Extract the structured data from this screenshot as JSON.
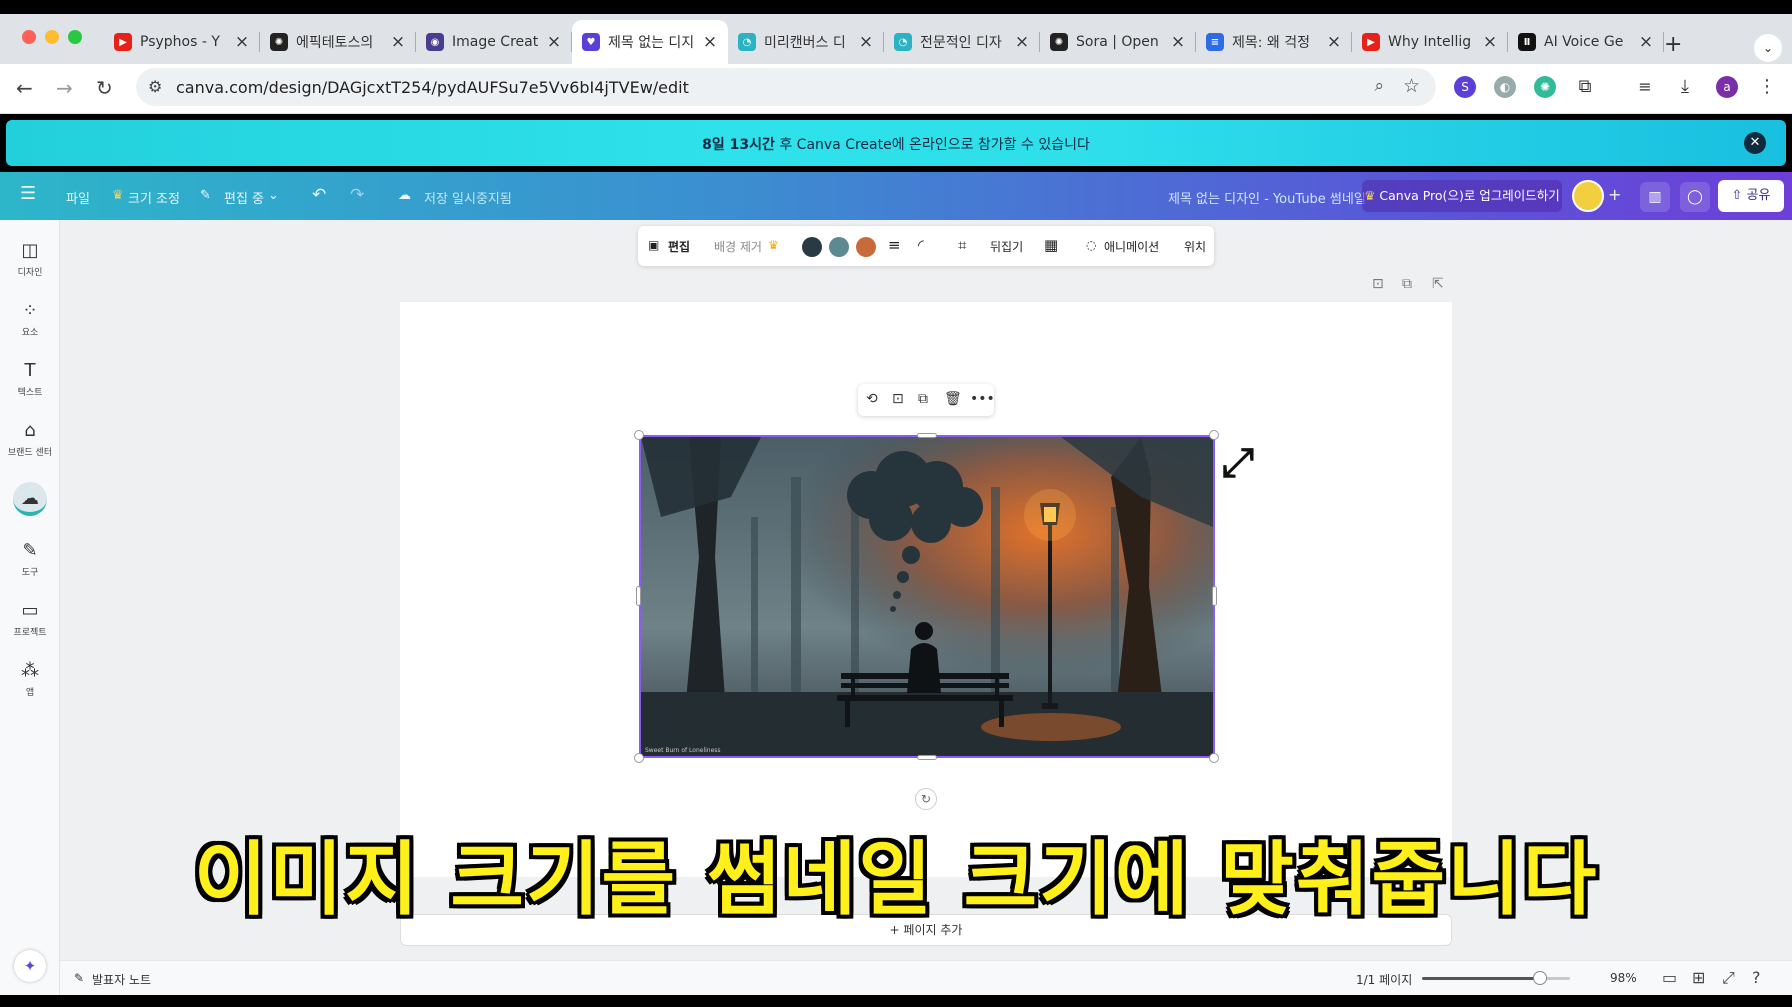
{
  "browser": {
    "tabs": [
      {
        "title": "Psyphos - Y",
        "icon": "youtube-icon",
        "color": "#e62117"
      },
      {
        "title": "에픽테토스의",
        "icon": "openai-icon",
        "color": "#222222"
      },
      {
        "title": "Image Creat",
        "icon": "image-creator-icon",
        "color": "#4a3d8f"
      },
      {
        "title": "제목 없는 디지",
        "icon": "canva-icon",
        "color": "#5b3fd9"
      },
      {
        "title": "미리캔버스 디",
        "icon": "miricanvas-icon",
        "color": "#2bb3c4"
      },
      {
        "title": "전문적인 디자",
        "icon": "miricanvas-icon",
        "color": "#2bb3c4"
      },
      {
        "title": "Sora | Open",
        "icon": "openai-icon",
        "color": "#222222"
      },
      {
        "title": "제목: 왜 걱정",
        "icon": "google-docs-icon",
        "color": "#2e6ce6"
      },
      {
        "title": "Why Intellig",
        "icon": "youtube-icon",
        "color": "#e62117"
      },
      {
        "title": "AI Voice Ge",
        "icon": "elevenlabs-icon",
        "color": "#111111"
      }
    ],
    "url": "canva.com/design/DAGjcxtT254/pydAUFSu7e5Vv6bI4jTVEw/edit",
    "profile_initial": "a"
  },
  "banner": {
    "bold": "8일 13시간",
    "rest": " 후 Canva Create에 온라인으로 참가할 수 있습니다"
  },
  "header": {
    "file": "파일",
    "resize": "크기 조정",
    "editing": "편집 중",
    "save_status": "저장 일시중지됨",
    "doc_title": "제목 없는 디자인 - YouTube 썸네일",
    "upgrade": "Canva Pro(으)로 업그레이드하기",
    "share": "공유"
  },
  "sidebar": [
    {
      "label": "디자인",
      "icon": "layout-icon"
    },
    {
      "label": "요소",
      "icon": "elements-icon"
    },
    {
      "label": "텍스트",
      "icon": "text-icon"
    },
    {
      "label": "브랜드 센터",
      "icon": "brand-icon"
    },
    {
      "label": "",
      "icon": "upload-cloud-icon"
    },
    {
      "label": "도구",
      "icon": "draw-icon"
    },
    {
      "label": "프로젝트",
      "icon": "folder-icon"
    },
    {
      "label": "앱",
      "icon": "apps-icon"
    }
  ],
  "context_toolbar": {
    "edit": "편집",
    "bg_remove": "배경 제거",
    "colors": [
      "#2a3a44",
      "#5d8a92",
      "#c86b3a"
    ],
    "flip": "뒤집기",
    "animate": "애니메이션",
    "position": "위치"
  },
  "image": {
    "watermark": "Sweet Burn of Loneliness"
  },
  "add_page": "+ 페이지 추가",
  "footer": {
    "notes": "발표자 노트",
    "page": "1/1 페이지",
    "zoom": "98%",
    "zoom_value": 98
  },
  "caption": "이미지 크기를 썸네일 크기에 맞춰줍니다"
}
